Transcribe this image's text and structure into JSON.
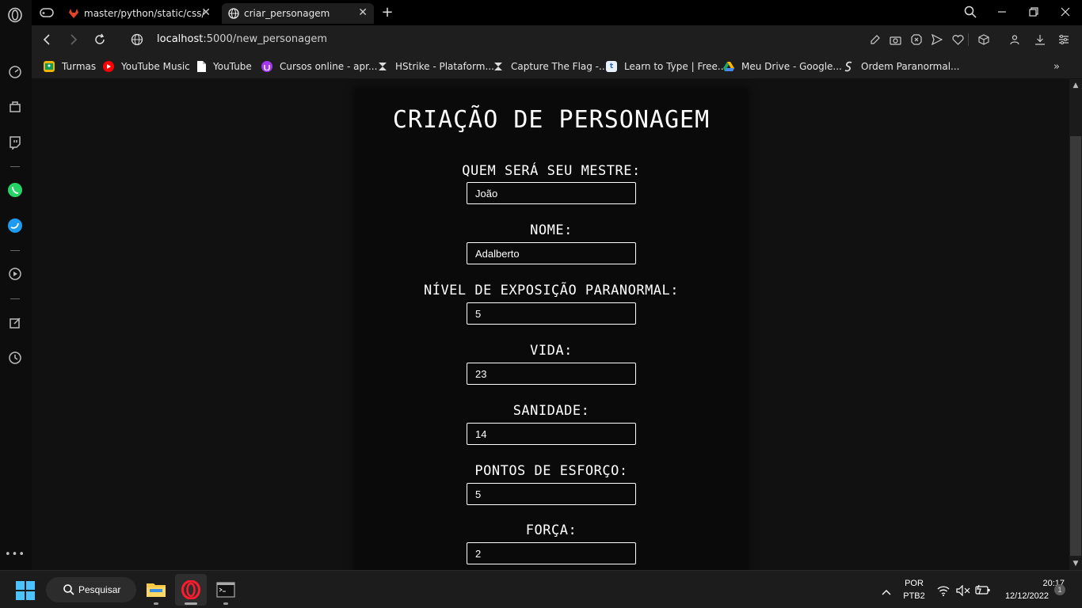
{
  "browser": {
    "tabs": [
      {
        "label": "master/python/static/css/u"
      },
      {
        "label": "criar_personagem"
      }
    ],
    "url": {
      "host": "localhost",
      "path": ":5000/new_personagem"
    },
    "bookmarks": [
      {
        "label": "Turmas",
        "icon": "classroom-icon",
        "color": "#f4b400"
      },
      {
        "label": "YouTube Music",
        "icon": "youtube-music-icon",
        "color": "#ff0000"
      },
      {
        "label": "YouTube",
        "icon": "page-icon",
        "color": "#ffffff"
      },
      {
        "label": "Cursos online - apr...",
        "icon": "udemy-icon",
        "color": "#a435f0"
      },
      {
        "label": "HStrike - Plataform...",
        "icon": "hstrike-icon",
        "color": "#dddddd"
      },
      {
        "label": "Capture The Flag -...",
        "icon": "ctf-icon",
        "color": "#dddddd"
      },
      {
        "label": "Learn to Type | Free...",
        "icon": "typing-icon",
        "color": "#4a90d9"
      },
      {
        "label": "Meu Drive - Google...",
        "icon": "google-drive-icon",
        "color": "#1fa463"
      },
      {
        "label": "Ordem Paranormal...",
        "icon": "ordem-icon",
        "color": "#dddddd"
      }
    ]
  },
  "page": {
    "title": "CRIAÇÃO DE PERSONAGEM",
    "fields": [
      {
        "label": "QUEM SERÁ SEU MESTRE:",
        "value": "João"
      },
      {
        "label": "NOME:",
        "value": "Adalberto"
      },
      {
        "label": "NÍVEL DE EXPOSIÇÃO PARANORMAL:",
        "value": "5"
      },
      {
        "label": "VIDA:",
        "value": "23"
      },
      {
        "label": "SANIDADE:",
        "value": "14"
      },
      {
        "label": "PONTOS DE ESFORÇO:",
        "value": "5"
      },
      {
        "label": "FORÇA:",
        "value": "2"
      }
    ]
  },
  "taskbar": {
    "search_label": "Pesquisar",
    "language": "POR",
    "keyboard": "PTB2",
    "time": "20:17",
    "date": "12/12/2022",
    "notification_count": "1"
  }
}
